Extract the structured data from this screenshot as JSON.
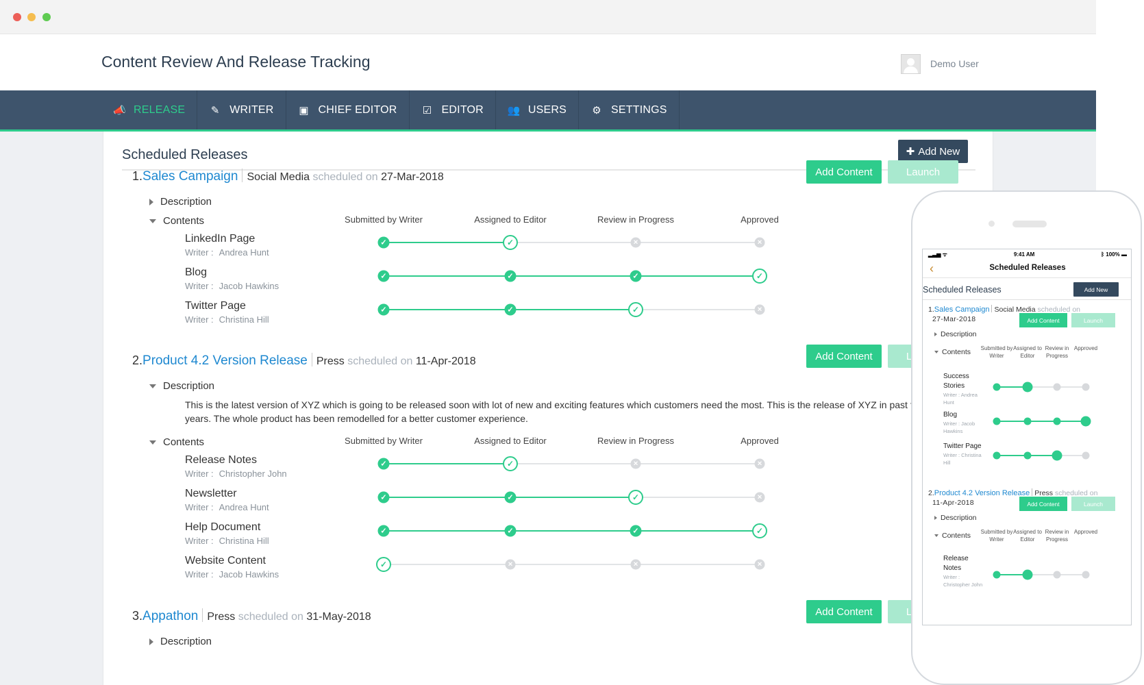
{
  "window": {
    "dots": [
      "#ec5f58",
      "#f5bd4f",
      "#5fcb52"
    ]
  },
  "app": {
    "title": "Content Review And Release Tracking",
    "user": "Demo User"
  },
  "nav": [
    {
      "label": "RELEASE",
      "icon": "megaphone-icon",
      "glyph": "📣",
      "active": true
    },
    {
      "label": "WRITER",
      "icon": "pencil-icon",
      "glyph": "✎",
      "active": false
    },
    {
      "label": "CHIEF EDITOR",
      "icon": "edit-box-icon",
      "glyph": "▣",
      "active": false
    },
    {
      "label": "EDITOR",
      "icon": "edit-square-icon",
      "glyph": "☑",
      "active": false
    },
    {
      "label": "USERS",
      "icon": "users-icon",
      "glyph": "👥",
      "active": false
    },
    {
      "label": "SETTINGS",
      "icon": "gears-icon",
      "glyph": "⚙",
      "active": false
    }
  ],
  "main": {
    "section_title": "Scheduled Releases",
    "add_new_label": "Add New"
  },
  "labels": {
    "description": "Description",
    "contents": "Contents",
    "writer_prefix": "Writer :",
    "scheduled_on": "scheduled on",
    "add_content": "Add Content",
    "launch": "Launch"
  },
  "stages": [
    "Submitted by Writer",
    "Assigned to Editor",
    "Review in Progress",
    "Approved"
  ],
  "releases": [
    {
      "number": "1.",
      "name": "Sales Campaign",
      "channel": "Social Media",
      "date": "27-Mar-2018",
      "description_open": false,
      "items": [
        {
          "name": "LinkedIn Page",
          "writer": "Andrea Hunt",
          "progress": 2
        },
        {
          "name": "Blog",
          "writer": "Jacob Hawkins",
          "progress": 4
        },
        {
          "name": "Twitter Page",
          "writer": "Christina Hill",
          "progress": 3
        }
      ]
    },
    {
      "number": "2.",
      "name": "Product 4.2 Version Release",
      "channel": "Press",
      "date": "11-Apr-2018",
      "description_open": true,
      "description": "This is the latest version of XYZ which is going to be released soon with lot of new and exciting features which customers need the most. This is the release of XYZ in past few years. The whole product has been remodelled for a better customer experience.",
      "items": [
        {
          "name": "Release Notes",
          "writer": "Christopher John",
          "progress": 2
        },
        {
          "name": "Newsletter",
          "writer": "Andrea Hunt",
          "progress": 3
        },
        {
          "name": "Help Document",
          "writer": "Christina Hill",
          "progress": 4
        },
        {
          "name": "Website Content",
          "writer": "Jacob Hawkins",
          "progress": 1
        }
      ]
    },
    {
      "number": "3.",
      "name": "Appathon",
      "channel": "Press",
      "date": "31-May-2018",
      "description_open": false,
      "items": []
    }
  ],
  "mobile": {
    "time": "9:41 AM",
    "battery": "100%",
    "title": "Scheduled Releases",
    "section_title": "Scheduled Releases",
    "add_new_label": "Add New",
    "stages": [
      "Submitted by Writer",
      "Assigned to Editor",
      "Review in Progress",
      "Approved"
    ],
    "releases": [
      {
        "number": "1.",
        "name": "Sales Campaign",
        "channel": "Social Media",
        "date": "27-Mar-2018",
        "items": [
          {
            "name": "Success Stories",
            "writer": "Andrea Hunt",
            "progress": 2
          },
          {
            "name": "Blog",
            "writer": "Jacob Hawkins",
            "progress": 4
          },
          {
            "name": "Twitter Page",
            "writer": "Christina Hill",
            "progress": 3
          }
        ]
      },
      {
        "number": "2.",
        "name": "Product 4.2 Version Release",
        "channel": "Press",
        "date": "11-Apr-2018",
        "items": [
          {
            "name": "Release Notes",
            "writer": "Christopher John",
            "progress": 2
          }
        ]
      }
    ]
  },
  "colors": {
    "accent": "#2ecc8c",
    "navbar": "#3e546c",
    "link": "#1e88d0",
    "pending": "#d7d9dc"
  }
}
